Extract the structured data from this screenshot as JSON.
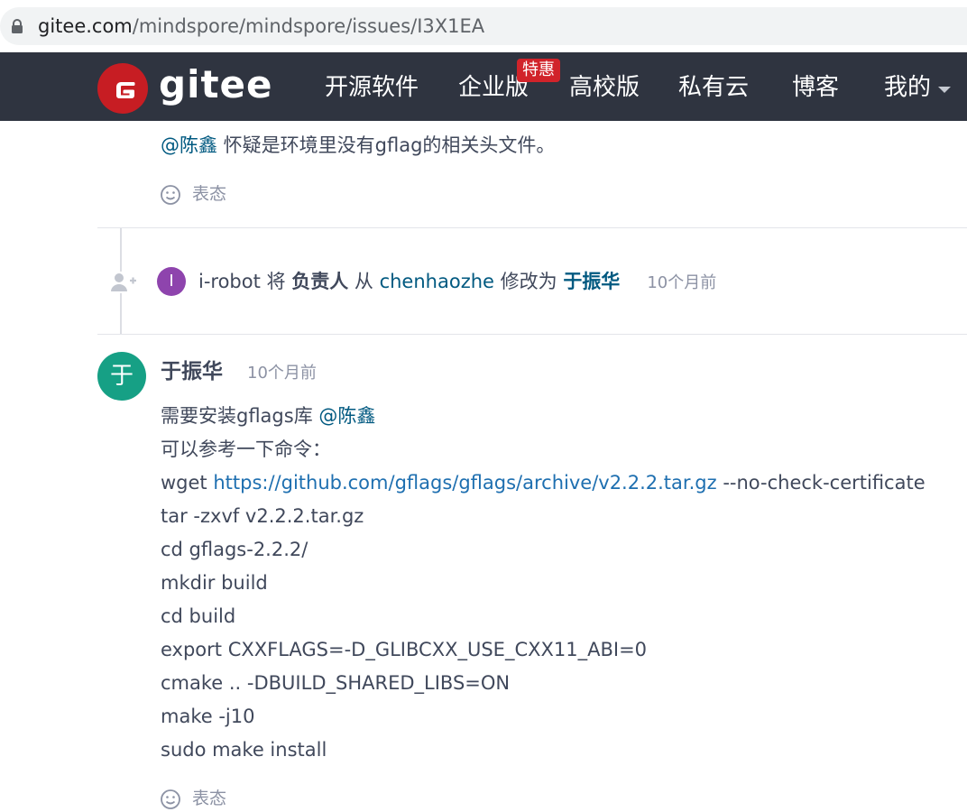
{
  "browser": {
    "url_host": "gitee.com",
    "url_path": "/mindspore/mindspore/issues/I3X1EA"
  },
  "nav": {
    "logo_text": "gitee",
    "items": [
      "开源软件",
      "企业版",
      "高校版",
      "私有云",
      "博客",
      "我的"
    ],
    "promo_badge": "特惠"
  },
  "comment_prev": {
    "mention": "@陈鑫",
    "text": " 怀疑是环境里没有gflag的相关头文件。",
    "reaction_label": "表态"
  },
  "event": {
    "avatar_initial": "I",
    "actor": "i-robot",
    "verb": " 将 ",
    "field": "负责人",
    "from_word": " 从 ",
    "old_value": "chenhaozhe",
    "change_word": " 修改为 ",
    "new_value": "于振华",
    "time": "10个月前"
  },
  "comment": {
    "avatar_initial": "于",
    "author": "于振华",
    "time": "10个月前",
    "line1_text": "需要安装gflags库 ",
    "line1_mention": "@陈鑫",
    "line2": "可以参考一下命令：",
    "line3_cmd": "wget ",
    "line3_link": "https://github.com/gflags/gflags/archive/v2.2.2.tar.gz",
    "line3_suffix": " --no-check-certificate",
    "lines": [
      "tar -zxvf v2.2.2.tar.gz",
      "cd gflags-2.2.2/",
      "mkdir build",
      "cd build",
      "export CXXFLAGS=-D_GLIBCXX_USE_CXX11_ABI=0",
      "cmake .. -DBUILD_SHARED_LIBS=ON",
      "make -j10",
      "sudo make install"
    ],
    "reaction_label": "表态"
  }
}
